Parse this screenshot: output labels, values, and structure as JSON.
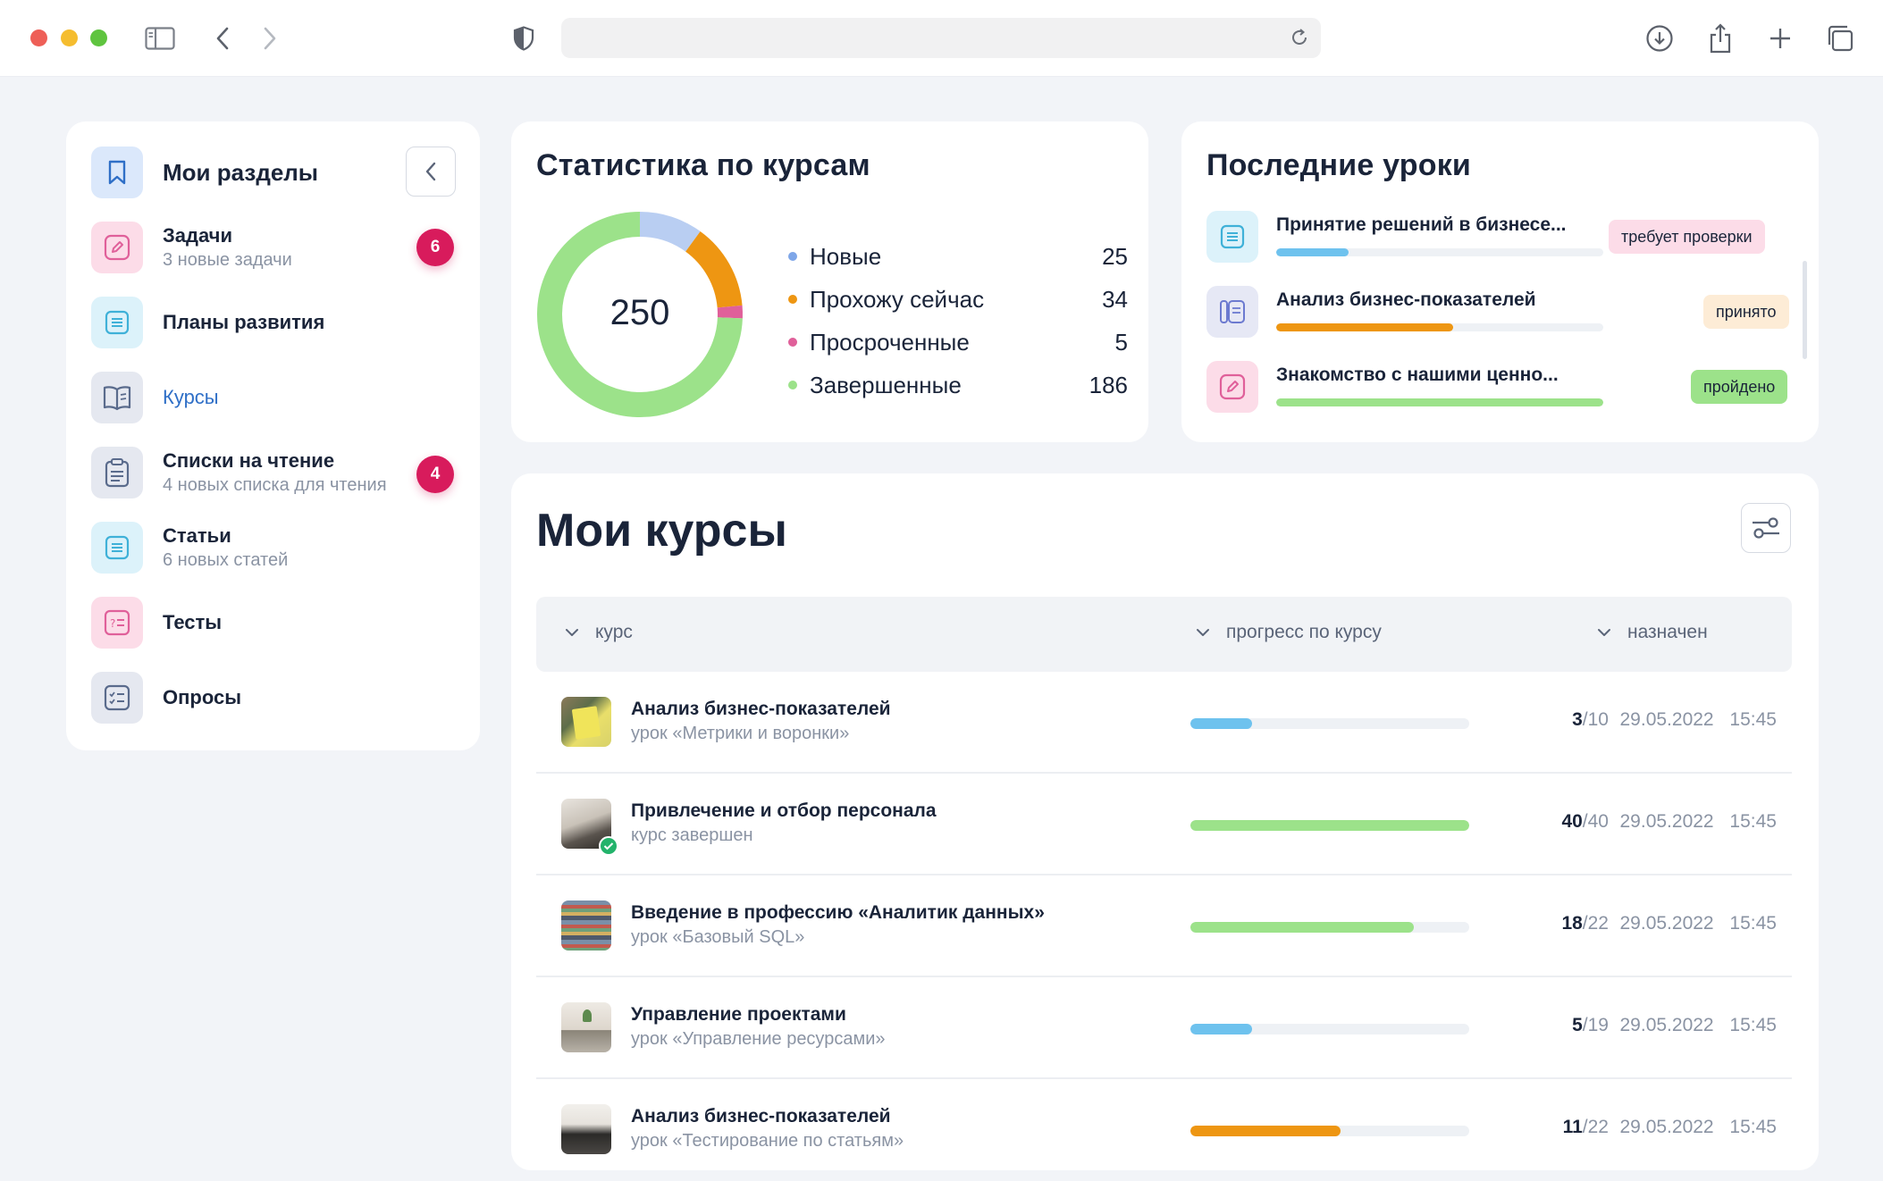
{
  "sidebar": {
    "header": "Мои разделы",
    "items": [
      {
        "label": "Задачи",
        "sub": "3 новые задачи",
        "badge": "6",
        "icon": "pencil-icon"
      },
      {
        "label": "Планы развития",
        "sub": "",
        "badge": "",
        "icon": "document-icon"
      },
      {
        "label": "Курсы",
        "sub": "",
        "badge": "",
        "icon": "book-icon"
      },
      {
        "label": "Списки на чтение",
        "sub": "4 новых списка для чтения",
        "badge": "4",
        "icon": "clipboard-icon"
      },
      {
        "label": "Статьи",
        "sub": "6 новых статей",
        "badge": "",
        "icon": "document-icon"
      },
      {
        "label": "Тесты",
        "sub": "",
        "badge": "",
        "icon": "quiz-icon"
      },
      {
        "label": "Опросы",
        "sub": "",
        "badge": "",
        "icon": "checklist-icon"
      }
    ]
  },
  "stats": {
    "title": "Статистика по курсам",
    "total": "250",
    "legend": [
      {
        "label": "Новые",
        "value": "25",
        "color": "#7ea6e8"
      },
      {
        "label": "Прохожу сейчас",
        "value": "34",
        "color": "#ee9612"
      },
      {
        "label": "Просроченные",
        "value": "5",
        "color": "#e0609a"
      },
      {
        "label": "Завершенные",
        "value": "186",
        "color": "#9ce28a"
      }
    ]
  },
  "recent": {
    "title": "Последние уроки",
    "lessons": [
      {
        "title": "Принятие решений в бизнесе...",
        "status": "требует проверки",
        "progress": 0.22,
        "bar_color": "#6ec2ee",
        "pill_color": "#fcdce8"
      },
      {
        "title": "Анализ бизнес-показателей",
        "status": "принято",
        "progress": 0.54,
        "bar_color": "#ee9612",
        "pill_color": "#fdecd6"
      },
      {
        "title": "Знакомство с нашими ценно...",
        "status": "пройдено",
        "progress": 1.0,
        "bar_color": "#9ce28a",
        "pill_color": "#9ce28a"
      }
    ]
  },
  "courses": {
    "title": "Мои курсы",
    "columns": {
      "course": "курс",
      "progress": "прогресс по курсу",
      "assigned": "назначен"
    },
    "rows": [
      {
        "title": "Анализ бизнес-показателей",
        "sub": "урок «Метрики и воронки»",
        "done": "3",
        "total": "/10",
        "progress": 0.22,
        "color": "#6ec2ee",
        "date": "29.05.2022 15:45",
        "completed": false
      },
      {
        "title": "Привлечение и отбор персонала",
        "sub": "курс завершен",
        "done": "40",
        "total": "/40",
        "progress": 1.0,
        "color": "#9ce28a",
        "date": "29.05.2022 15:45",
        "completed": true
      },
      {
        "title": "Введение в профессию «Аналитик данных»",
        "sub": "урок «Базовый SQL»",
        "done": "18",
        "total": "/22",
        "progress": 0.8,
        "color": "#9ce28a",
        "date": "29.05.2022 15:45",
        "completed": false
      },
      {
        "title": "Управление проектами",
        "sub": "урок «Управление ресурсами»",
        "done": "5",
        "total": "/19",
        "progress": 0.22,
        "color": "#6ec2ee",
        "date": "29.05.2022 15:45",
        "completed": false
      },
      {
        "title": "Анализ бизнес-показателей",
        "sub": "урок «Тестирование по статьям»",
        "done": "11",
        "total": "/22",
        "progress": 0.54,
        "color": "#ee9612",
        "date": "29.05.2022 15:45",
        "completed": false
      }
    ]
  }
}
